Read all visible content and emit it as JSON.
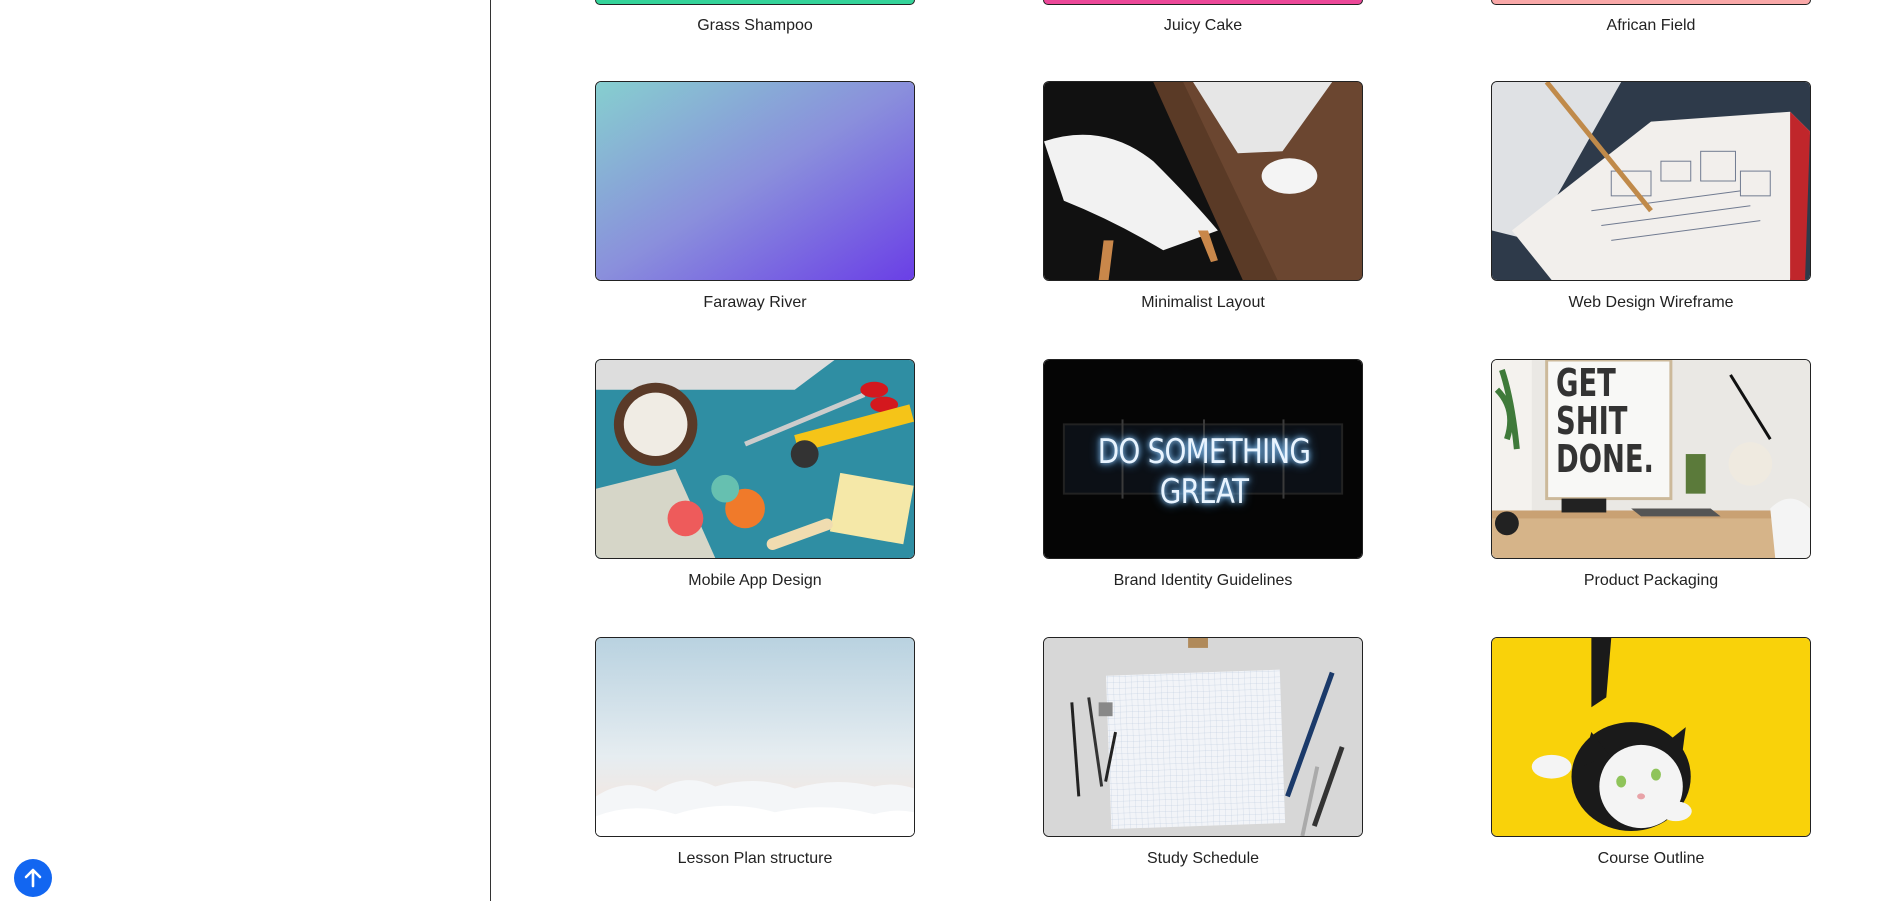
{
  "scroll_top": {
    "icon": "arrow-up-icon"
  },
  "partial_row": [
    {
      "title": "Grass Shampoo",
      "color": "#34d399"
    },
    {
      "title": "Juicy Cake",
      "color": "#ec4899"
    },
    {
      "title": "African Field",
      "color": "#f9a8a8"
    }
  ],
  "cards": [
    {
      "title": "Faraway River"
    },
    {
      "title": "Minimalist Layout"
    },
    {
      "title": "Web Design Wireframe"
    },
    {
      "title": "Mobile App Design"
    },
    {
      "title": "Brand Identity Guidelines"
    },
    {
      "title": "Product Packaging"
    },
    {
      "title": "Lesson Plan structure"
    },
    {
      "title": "Study Schedule"
    },
    {
      "title": "Course Outline"
    }
  ],
  "neon_text": "DO SOMETHING GREAT",
  "poster_text": [
    "GET",
    "SHIT",
    "DONE."
  ]
}
